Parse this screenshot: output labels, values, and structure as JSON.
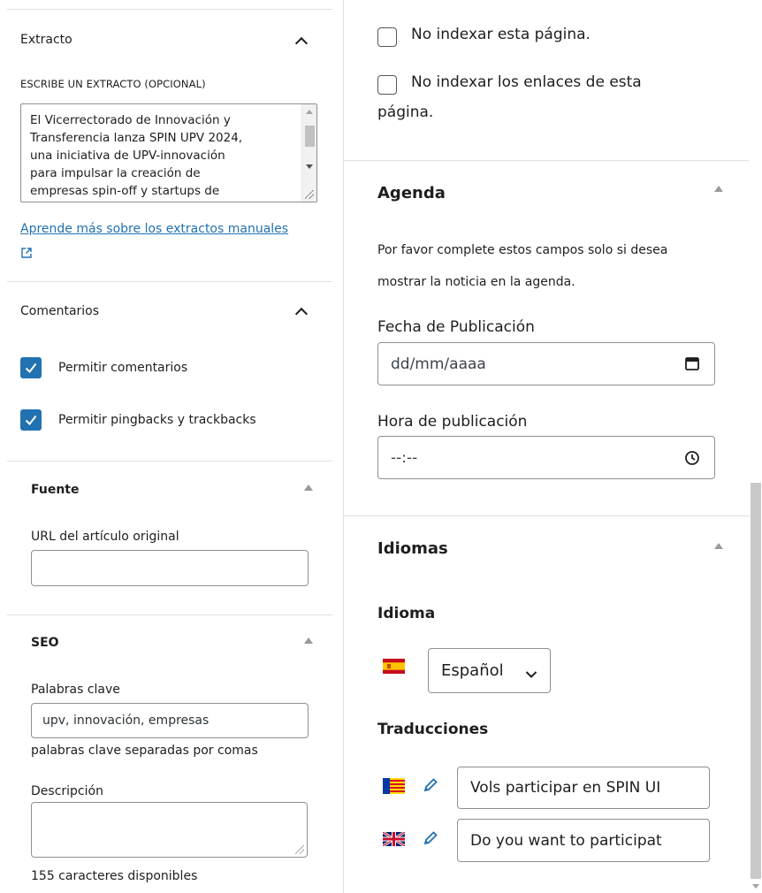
{
  "left": {
    "excerpt": {
      "title": "Extracto",
      "label": "ESCRIBE UN EXTRACTO (OPCIONAL)",
      "text": "El Vicerrectorado de Innovación y\nTransferencia lanza SPIN UPV 2024,\nuna iniciativa de UPV-innovación\npara impulsar la creación de\nempresas spin-off y startups de\nbase tecnológica",
      "learn_more_link": "Aprende más sobre los extractos manuales"
    },
    "comments": {
      "title": "Comentarios",
      "allow_comments": {
        "label": "Permitir comentarios",
        "checked": true
      },
      "allow_pingbacks": {
        "label": "Permitir pingbacks y trackbacks",
        "checked": true
      }
    },
    "source": {
      "title": "Fuente",
      "url_label": "URL del artículo original",
      "url_value": ""
    },
    "seo": {
      "title": "SEO",
      "keywords_label": "Palabras clave",
      "keywords_value": "upv, innovación, empresas",
      "keywords_help": "palabras clave separadas por comas",
      "description_label": "Descripción",
      "description_value": "",
      "chars_available": "155 caracteres disponibles"
    }
  },
  "right": {
    "noindex_page": {
      "label": "No indexar esta página.",
      "checked": false
    },
    "noindex_links": {
      "label_line1": "No indexar los enlaces de esta",
      "label_line2": "página.",
      "checked": false
    },
    "agenda": {
      "title": "Agenda",
      "help_line1": "Por favor complete estos campos solo si desea",
      "help_line2": "mostrar la noticia en la agenda.",
      "pub_date_label": "Fecha de Publicación",
      "pub_date_placeholder": "dd/mm/aaaa",
      "pub_time_label": "Hora de publicación",
      "pub_time_placeholder": "--:--"
    },
    "languages": {
      "title": "Idiomas",
      "language_label": "Idioma",
      "language_selected": "Español",
      "translations_label": "Traducciones",
      "translations": [
        {
          "flag": "catalan-flag-icon",
          "value": "Vols participar en SPIN UI"
        },
        {
          "flag": "uk-flag-icon",
          "value": "Do you want to participat"
        }
      ]
    }
  },
  "colors": {
    "accent": "#2271b1",
    "border": "#8c8f94",
    "divider": "#e0e0e0"
  }
}
